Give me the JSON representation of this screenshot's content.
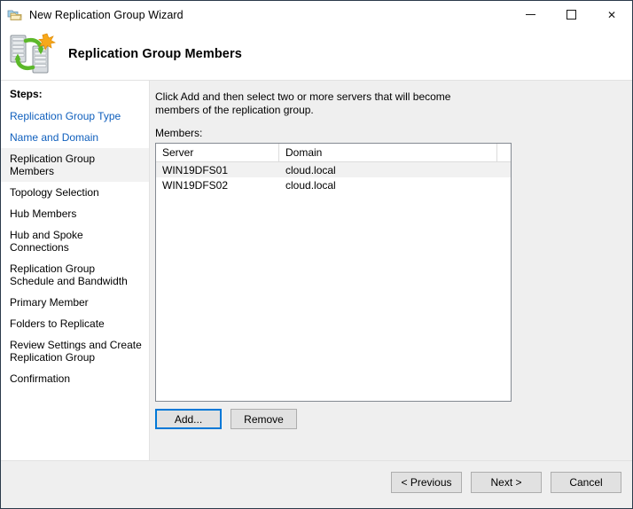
{
  "window": {
    "title": "New Replication Group Wizard",
    "title_icon": "replication-folders-icon",
    "caption": {
      "minimize": "minimize-icon",
      "maximize": "maximize-icon",
      "close": "close-icon",
      "close_glyph": "✕"
    }
  },
  "banner": {
    "icon": "replication-servers-icon",
    "title": "Replication Group Members"
  },
  "sidebar": {
    "heading": "Steps:",
    "items": [
      {
        "label": "Replication Group Type",
        "state": "done"
      },
      {
        "label": "Name and Domain",
        "state": "done"
      },
      {
        "label": "Replication Group Members",
        "state": "current"
      },
      {
        "label": "Topology Selection",
        "state": "pending"
      },
      {
        "label": "Hub Members",
        "state": "pending"
      },
      {
        "label": "Hub and Spoke Connections",
        "state": "pending"
      },
      {
        "label": "Replication Group Schedule and Bandwidth",
        "state": "pending"
      },
      {
        "label": "Primary Member",
        "state": "pending"
      },
      {
        "label": "Folders to Replicate",
        "state": "pending"
      },
      {
        "label": "Review Settings and Create Replication Group",
        "state": "pending"
      },
      {
        "label": "Confirmation",
        "state": "pending"
      }
    ]
  },
  "main": {
    "instruction": "Click Add and then select two or more servers that will become members of the replication group.",
    "members_label": "Members:",
    "table": {
      "columns": [
        "Server",
        "Domain"
      ],
      "rows": [
        {
          "server": "WIN19DFS01",
          "domain": "cloud.local"
        },
        {
          "server": "WIN19DFS02",
          "domain": "cloud.local"
        }
      ]
    },
    "buttons": {
      "add": "Add...",
      "remove": "Remove"
    }
  },
  "footer": {
    "previous": "< Previous",
    "next": "Next >",
    "cancel": "Cancel"
  },
  "colors": {
    "accent": "#0078d7",
    "link": "#0f5fbd",
    "panel": "#efefef",
    "selected_step": "#f2f2f2",
    "alt_row": "#f1f1f1",
    "border": "#848a92"
  }
}
